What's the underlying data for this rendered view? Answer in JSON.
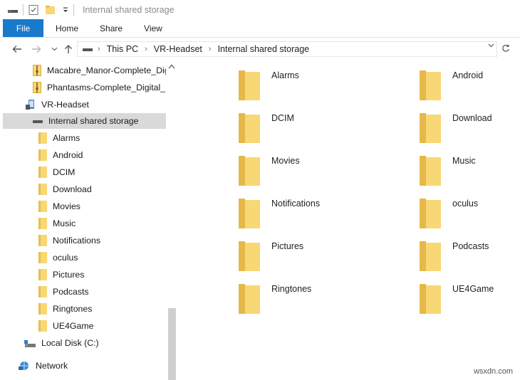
{
  "title": "Internal shared storage",
  "ribbon": {
    "tabs": [
      "File",
      "Home",
      "Share",
      "View"
    ]
  },
  "address": {
    "crumbs": [
      "This PC",
      "VR-Headset",
      "Internal shared storage"
    ]
  },
  "nav": {
    "items": [
      {
        "label": "Macabre_Manor-Complete_Digi",
        "icon": "zip-folder-icon",
        "selected": false
      },
      {
        "label": "Phantasms-Complete_Digital_De",
        "icon": "zip-folder-icon",
        "selected": false
      },
      {
        "label": "VR-Headset",
        "icon": "device-icon",
        "selected": false
      },
      {
        "label": "Internal shared storage",
        "icon": "drive-icon",
        "selected": true
      },
      {
        "label": "Alarms",
        "icon": "folder-icon",
        "selected": false
      },
      {
        "label": "Android",
        "icon": "folder-icon",
        "selected": false
      },
      {
        "label": "DCIM",
        "icon": "folder-icon",
        "selected": false
      },
      {
        "label": "Download",
        "icon": "folder-icon",
        "selected": false
      },
      {
        "label": "Movies",
        "icon": "folder-icon",
        "selected": false
      },
      {
        "label": "Music",
        "icon": "folder-icon",
        "selected": false
      },
      {
        "label": "Notifications",
        "icon": "folder-icon",
        "selected": false
      },
      {
        "label": "oculus",
        "icon": "folder-icon",
        "selected": false
      },
      {
        "label": "Pictures",
        "icon": "folder-icon",
        "selected": false
      },
      {
        "label": "Podcasts",
        "icon": "folder-icon",
        "selected": false
      },
      {
        "label": "Ringtones",
        "icon": "folder-icon",
        "selected": false
      },
      {
        "label": "UE4Game",
        "icon": "folder-icon",
        "selected": false
      },
      {
        "label": "Local Disk (C:)",
        "icon": "local-disk-icon",
        "selected": false
      },
      {
        "label": "Network",
        "icon": "network-icon",
        "selected": false
      }
    ]
  },
  "content": {
    "folders": [
      "Alarms",
      "Android",
      "DCIM",
      "Download",
      "Movies",
      "Music",
      "Notifications",
      "oculus",
      "Pictures",
      "Podcasts",
      "Ringtones",
      "UE4Game"
    ]
  },
  "watermark": "wsxdn.com",
  "colors": {
    "accent": "#1979ca",
    "folder": "#f8d775",
    "folder_dark": "#e0b441",
    "selection": "#d9d9d9"
  }
}
